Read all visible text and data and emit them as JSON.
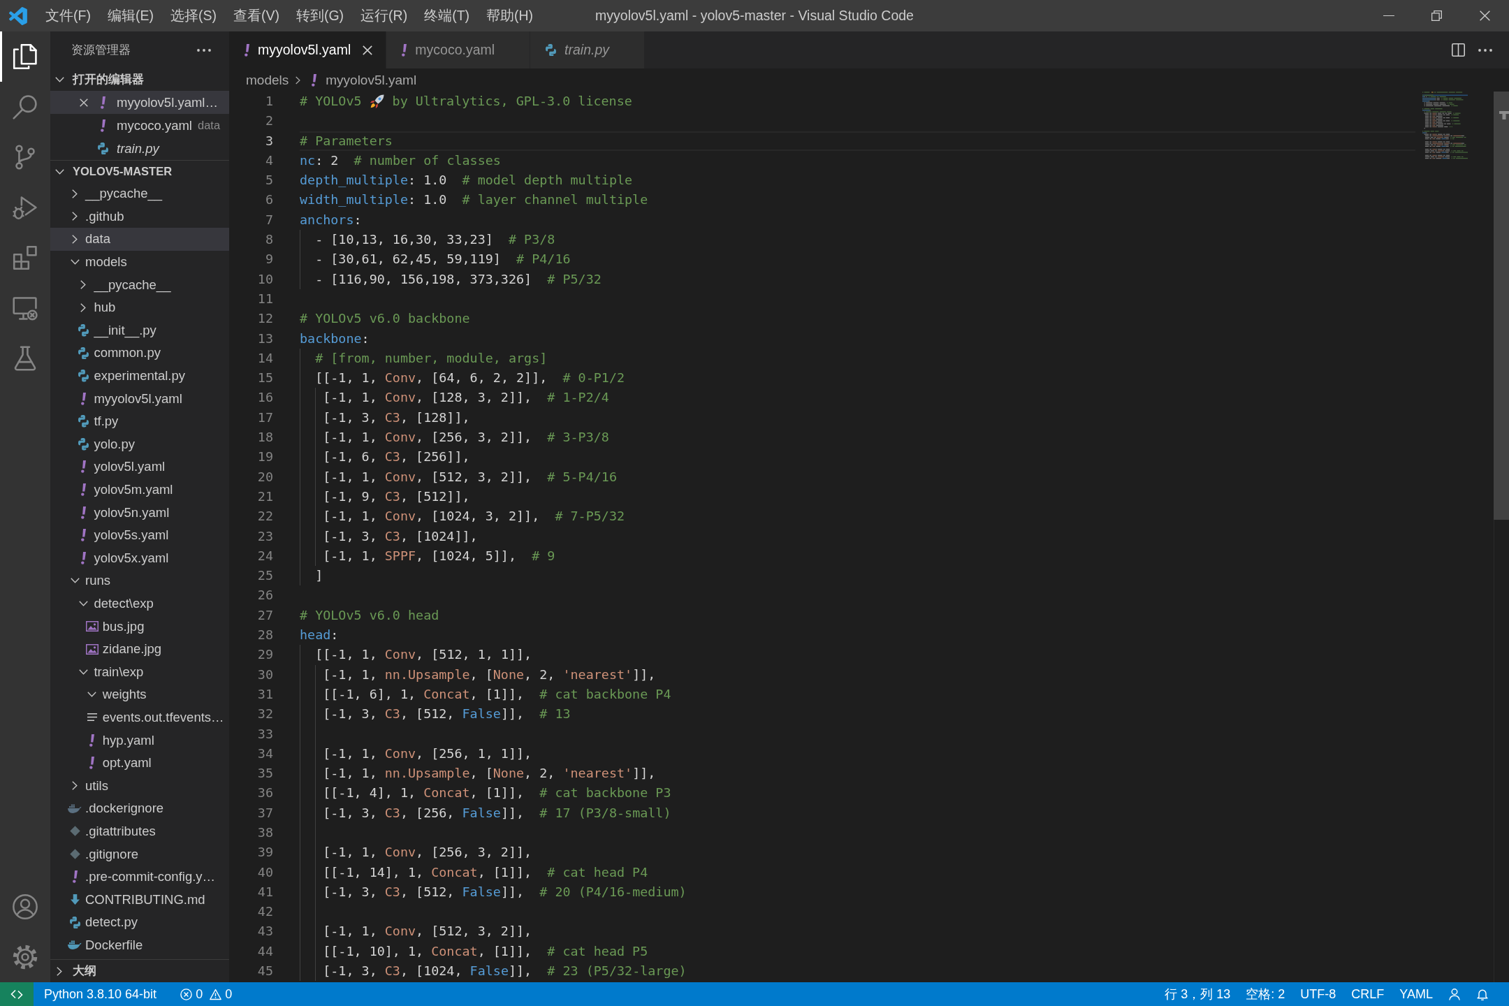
{
  "window": {
    "title": "myyolov5l.yaml - yolov5-master - Visual Studio Code"
  },
  "menu": [
    "文件(F)",
    "编辑(E)",
    "选择(S)",
    "查看(V)",
    "转到(G)",
    "运行(R)",
    "终端(T)",
    "帮助(H)"
  ],
  "activity_bar": {
    "items": [
      {
        "kind": "explorer",
        "selected": true
      },
      {
        "kind": "search",
        "selected": false
      },
      {
        "kind": "source_control",
        "selected": false
      },
      {
        "kind": "run_debug",
        "selected": false
      },
      {
        "kind": "extensions",
        "selected": false
      },
      {
        "kind": "remote",
        "selected": false
      },
      {
        "kind": "testing",
        "selected": false
      }
    ],
    "bottom": [
      {
        "kind": "account"
      },
      {
        "kind": "settings"
      }
    ]
  },
  "sidebar": {
    "title": "资源管理器",
    "sections": [
      {
        "kind": "open_editors",
        "title": "打开的编辑器",
        "expanded": true,
        "items": [
          {
            "name": "myyolov5l.yaml…",
            "kind": "yaml",
            "selected": true,
            "preview": false
          },
          {
            "name": "mycoco.yaml",
            "description": "data",
            "kind": "yaml",
            "selected": false,
            "preview": false
          },
          {
            "name": "train.py",
            "kind": "python",
            "selected": false,
            "preview": true
          }
        ]
      },
      {
        "kind": "folder",
        "title": "YOLOV5-MASTER",
        "expanded": true,
        "items": [
          {
            "name": "__pycache__",
            "kind": "folder",
            "expanded": false,
            "selected": false
          },
          {
            "name": ".github",
            "kind": "folder",
            "expanded": false,
            "selected": false
          },
          {
            "name": "data",
            "kind": "folder",
            "expanded": false,
            "selected": true
          },
          {
            "name": "models",
            "kind": "folder",
            "expanded": true,
            "selected": false,
            "children": [
              {
                "name": "__pycache__",
                "kind": "folder",
                "expanded": false,
                "selected": false
              },
              {
                "name": "hub",
                "kind": "folder",
                "expanded": false,
                "selected": false
              },
              {
                "name": "__init__.py",
                "kind": "python",
                "selected": false
              },
              {
                "name": "common.py",
                "kind": "python",
                "selected": false
              },
              {
                "name": "experimental.py",
                "kind": "python",
                "selected": false
              },
              {
                "name": "myyolov5l.yaml",
                "kind": "yaml",
                "selected": false
              },
              {
                "name": "tf.py",
                "kind": "python",
                "selected": false
              },
              {
                "name": "yolo.py",
                "kind": "python",
                "selected": false
              },
              {
                "name": "yolov5l.yaml",
                "kind": "yaml",
                "selected": false
              },
              {
                "name": "yolov5m.yaml",
                "kind": "yaml",
                "selected": false
              },
              {
                "name": "yolov5n.yaml",
                "kind": "yaml",
                "selected": false
              },
              {
                "name": "yolov5s.yaml",
                "kind": "yaml",
                "selected": false
              },
              {
                "name": "yolov5x.yaml",
                "kind": "yaml",
                "selected": false
              }
            ]
          },
          {
            "name": "runs",
            "kind": "folder",
            "expanded": true,
            "selected": false,
            "children": [
              {
                "name": "detect\\exp",
                "kind": "folder",
                "expanded": true,
                "selected": false,
                "children": [
                  {
                    "name": "bus.jpg",
                    "kind": "image",
                    "selected": false
                  },
                  {
                    "name": "zidane.jpg",
                    "kind": "image",
                    "selected": false
                  }
                ]
              },
              {
                "name": "train\\exp",
                "kind": "folder",
                "expanded": true,
                "selected": false,
                "children": [
                  {
                    "name": "weights",
                    "kind": "folder",
                    "expanded": true,
                    "selected": false
                  },
                  {
                    "name": "events.out.tfevents…",
                    "kind": "text",
                    "selected": false
                  },
                  {
                    "name": "hyp.yaml",
                    "kind": "yaml",
                    "selected": false
                  },
                  {
                    "name": "opt.yaml",
                    "kind": "yaml",
                    "selected": false
                  }
                ]
              }
            ]
          },
          {
            "name": "utils",
            "kind": "folder",
            "expanded": false,
            "selected": false
          },
          {
            "name": ".dockerignore",
            "kind": "docker_ignore",
            "selected": false
          },
          {
            "name": ".gitattributes",
            "kind": "git",
            "selected": false
          },
          {
            "name": ".gitignore",
            "kind": "git",
            "selected": false
          },
          {
            "name": ".pre-commit-config.y…",
            "kind": "yaml",
            "selected": false
          },
          {
            "name": "CONTRIBUTING.md",
            "kind": "markdown",
            "selected": false
          },
          {
            "name": "detect.py",
            "kind": "python",
            "selected": false
          },
          {
            "name": "Dockerfile",
            "kind": "docker",
            "selected": false
          }
        ]
      },
      {
        "kind": "outline",
        "title": "大纲",
        "expanded": false
      }
    ]
  },
  "tabs": [
    {
      "label": "myyolov5l.yaml",
      "kind": "yaml",
      "selected": true,
      "preview": false
    },
    {
      "label": "mycoco.yaml",
      "kind": "yaml",
      "selected": false,
      "preview": false
    },
    {
      "label": "train.py",
      "kind": "python",
      "selected": false,
      "preview": true
    }
  ],
  "breadcrumb": [
    {
      "label": "models",
      "kind": "folder"
    },
    {
      "label": "myyolov5l.yaml",
      "kind": "yaml"
    }
  ],
  "editor": {
    "lines": [
      {
        "number": "1",
        "current": false,
        "tokens": [
          {
            "kind": "comment",
            "text": "# YOLOv5"
          },
          {
            "kind": "emoji"
          },
          {
            "kind": "comment",
            "text": "by Ultralytics, GPL-3.0 license"
          }
        ]
      },
      {
        "number": "2",
        "current": false
      },
      {
        "number": "3",
        "current": true,
        "tokens": [
          {
            "kind": "comment",
            "text": "# Parameters"
          }
        ]
      },
      {
        "number": "4",
        "current": false,
        "tokens": [
          {
            "kind": "key",
            "text": "nc"
          },
          {
            "kind": "plain",
            "text": ": 2  "
          },
          {
            "kind": "comment",
            "text": "# number of classes"
          }
        ]
      },
      {
        "number": "5",
        "current": false,
        "tokens": [
          {
            "kind": "key",
            "text": "depth_multiple"
          },
          {
            "kind": "plain",
            "text": ": 1.0  "
          },
          {
            "kind": "comment",
            "text": "# model depth multiple"
          }
        ]
      },
      {
        "number": "6",
        "current": false,
        "tokens": [
          {
            "kind": "key",
            "text": "width_multiple"
          },
          {
            "kind": "plain",
            "text": ": 1.0  "
          },
          {
            "kind": "comment",
            "text": "# layer channel multiple"
          }
        ]
      },
      {
        "number": "7",
        "current": false,
        "tokens": [
          {
            "kind": "key",
            "text": "anchors"
          },
          {
            "kind": "plain",
            "text": ":"
          }
        ]
      },
      {
        "number": "8",
        "current": false,
        "tokens": [
          {
            "kind": "plain",
            "text": "  - [10,13, 16,30, 33,23]  "
          },
          {
            "kind": "comment",
            "text": "# P3/8"
          }
        ]
      },
      {
        "number": "9",
        "current": false,
        "tokens": [
          {
            "kind": "plain",
            "text": "  - [30,61, 62,45, 59,119]  "
          },
          {
            "kind": "comment",
            "text": "# P4/16"
          }
        ]
      },
      {
        "number": "10",
        "current": false,
        "tokens": [
          {
            "kind": "plain",
            "text": "  - [116,90, 156,198, 373,326]  "
          },
          {
            "kind": "comment",
            "text": "# P5/32"
          }
        ]
      },
      {
        "number": "11",
        "current": false
      },
      {
        "number": "12",
        "current": false,
        "tokens": [
          {
            "kind": "comment",
            "text": "# YOLOv5 v6.0 backbone"
          }
        ]
      },
      {
        "number": "13",
        "current": false,
        "tokens": [
          {
            "kind": "key",
            "text": "backbone"
          },
          {
            "kind": "plain",
            "text": ":"
          }
        ]
      },
      {
        "number": "14",
        "current": false,
        "tokens": [
          {
            "kind": "comment",
            "text": "  # [from, number, module, args]"
          }
        ]
      },
      {
        "number": "15",
        "current": false,
        "tokens": [
          {
            "kind": "plain",
            "text": "  [[-1, 1, "
          },
          {
            "kind": "string",
            "text": "Conv"
          },
          {
            "kind": "plain",
            "text": ", [64, 6, 2, 2]],  "
          },
          {
            "kind": "comment",
            "text": "# 0-P1/2"
          }
        ]
      },
      {
        "number": "16",
        "current": false,
        "tokens": [
          {
            "kind": "plain",
            "text": "   [-1, 1, "
          },
          {
            "kind": "string",
            "text": "Conv"
          },
          {
            "kind": "plain",
            "text": ", [128, 3, 2]],  "
          },
          {
            "kind": "comment",
            "text": "# 1-P2/4"
          }
        ]
      },
      {
        "number": "17",
        "current": false,
        "tokens": [
          {
            "kind": "plain",
            "text": "   [-1, 3, "
          },
          {
            "kind": "string",
            "text": "C3"
          },
          {
            "kind": "plain",
            "text": ", [128]],"
          }
        ]
      },
      {
        "number": "18",
        "current": false,
        "tokens": [
          {
            "kind": "plain",
            "text": "   [-1, 1, "
          },
          {
            "kind": "string",
            "text": "Conv"
          },
          {
            "kind": "plain",
            "text": ", [256, 3, 2]],  "
          },
          {
            "kind": "comment",
            "text": "# 3-P3/8"
          }
        ]
      },
      {
        "number": "19",
        "current": false,
        "tokens": [
          {
            "kind": "plain",
            "text": "   [-1, 6, "
          },
          {
            "kind": "string",
            "text": "C3"
          },
          {
            "kind": "plain",
            "text": ", [256]],"
          }
        ]
      },
      {
        "number": "20",
        "current": false,
        "tokens": [
          {
            "kind": "plain",
            "text": "   [-1, 1, "
          },
          {
            "kind": "string",
            "text": "Conv"
          },
          {
            "kind": "plain",
            "text": ", [512, 3, 2]],  "
          },
          {
            "kind": "comment",
            "text": "# 5-P4/16"
          }
        ]
      },
      {
        "number": "21",
        "current": false,
        "tokens": [
          {
            "kind": "plain",
            "text": "   [-1, 9, "
          },
          {
            "kind": "string",
            "text": "C3"
          },
          {
            "kind": "plain",
            "text": ", [512]],"
          }
        ]
      },
      {
        "number": "22",
        "current": false,
        "tokens": [
          {
            "kind": "plain",
            "text": "   [-1, 1, "
          },
          {
            "kind": "string",
            "text": "Conv"
          },
          {
            "kind": "plain",
            "text": ", [1024, 3, 2]],  "
          },
          {
            "kind": "comment",
            "text": "# 7-P5/32"
          }
        ]
      },
      {
        "number": "23",
        "current": false,
        "tokens": [
          {
            "kind": "plain",
            "text": "   [-1, 3, "
          },
          {
            "kind": "string",
            "text": "C3"
          },
          {
            "kind": "plain",
            "text": ", [1024]],"
          }
        ]
      },
      {
        "number": "24",
        "current": false,
        "tokens": [
          {
            "kind": "plain",
            "text": "   [-1, 1, "
          },
          {
            "kind": "string",
            "text": "SPPF"
          },
          {
            "kind": "plain",
            "text": ", [1024, 5]],  "
          },
          {
            "kind": "comment",
            "text": "# 9"
          }
        ]
      },
      {
        "number": "25",
        "current": false,
        "tokens": [
          {
            "kind": "plain",
            "text": "  ]"
          }
        ]
      },
      {
        "number": "26",
        "current": false
      },
      {
        "number": "27",
        "current": false,
        "tokens": [
          {
            "kind": "comment",
            "text": "# YOLOv5 v6.0 head"
          }
        ]
      },
      {
        "number": "28",
        "current": false,
        "tokens": [
          {
            "kind": "key",
            "text": "head"
          },
          {
            "kind": "plain",
            "text": ":"
          }
        ]
      },
      {
        "number": "29",
        "current": false,
        "tokens": [
          {
            "kind": "plain",
            "text": "  [[-1, 1, "
          },
          {
            "kind": "string",
            "text": "Conv"
          },
          {
            "kind": "plain",
            "text": ", [512, 1, 1]],"
          }
        ]
      },
      {
        "number": "30",
        "current": false,
        "tokens": [
          {
            "kind": "plain",
            "text": "   [-1, 1, "
          },
          {
            "kind": "string",
            "text": "nn.Upsample"
          },
          {
            "kind": "plain",
            "text": ", ["
          },
          {
            "kind": "string",
            "text": "None"
          },
          {
            "kind": "plain",
            "text": ", 2, "
          },
          {
            "kind": "string",
            "text": "'nearest'"
          },
          {
            "kind": "plain",
            "text": "]],"
          }
        ]
      },
      {
        "number": "31",
        "current": false,
        "tokens": [
          {
            "kind": "plain",
            "text": "   [[-1, 6], 1, "
          },
          {
            "kind": "string",
            "text": "Concat"
          },
          {
            "kind": "plain",
            "text": ", [1]],  "
          },
          {
            "kind": "comment",
            "text": "# cat backbone P4"
          }
        ]
      },
      {
        "number": "32",
        "current": false,
        "tokens": [
          {
            "kind": "plain",
            "text": "   [-1, 3, "
          },
          {
            "kind": "string",
            "text": "C3"
          },
          {
            "kind": "plain",
            "text": ", [512, "
          },
          {
            "kind": "bool",
            "text": "False"
          },
          {
            "kind": "plain",
            "text": "]],  "
          },
          {
            "kind": "comment",
            "text": "# 13"
          }
        ]
      },
      {
        "number": "33",
        "current": false
      },
      {
        "number": "34",
        "current": false,
        "tokens": [
          {
            "kind": "plain",
            "text": "   [-1, 1, "
          },
          {
            "kind": "string",
            "text": "Conv"
          },
          {
            "kind": "plain",
            "text": ", [256, 1, 1]],"
          }
        ]
      },
      {
        "number": "35",
        "current": false,
        "tokens": [
          {
            "kind": "plain",
            "text": "   [-1, 1, "
          },
          {
            "kind": "string",
            "text": "nn.Upsample"
          },
          {
            "kind": "plain",
            "text": ", ["
          },
          {
            "kind": "string",
            "text": "None"
          },
          {
            "kind": "plain",
            "text": ", 2, "
          },
          {
            "kind": "string",
            "text": "'nearest'"
          },
          {
            "kind": "plain",
            "text": "]],"
          }
        ]
      },
      {
        "number": "36",
        "current": false,
        "tokens": [
          {
            "kind": "plain",
            "text": "   [[-1, 4], 1, "
          },
          {
            "kind": "string",
            "text": "Concat"
          },
          {
            "kind": "plain",
            "text": ", [1]],  "
          },
          {
            "kind": "comment",
            "text": "# cat backbone P3"
          }
        ]
      },
      {
        "number": "37",
        "current": false,
        "tokens": [
          {
            "kind": "plain",
            "text": "   [-1, 3, "
          },
          {
            "kind": "string",
            "text": "C3"
          },
          {
            "kind": "plain",
            "text": ", [256, "
          },
          {
            "kind": "bool",
            "text": "False"
          },
          {
            "kind": "plain",
            "text": "]],  "
          },
          {
            "kind": "comment",
            "text": "# 17 (P3/8-small)"
          }
        ]
      },
      {
        "number": "38",
        "current": false
      },
      {
        "number": "39",
        "current": false,
        "tokens": [
          {
            "kind": "plain",
            "text": "   [-1, 1, "
          },
          {
            "kind": "string",
            "text": "Conv"
          },
          {
            "kind": "plain",
            "text": ", [256, 3, 2]],"
          }
        ]
      },
      {
        "number": "40",
        "current": false,
        "tokens": [
          {
            "kind": "plain",
            "text": "   [[-1, 14], 1, "
          },
          {
            "kind": "string",
            "text": "Concat"
          },
          {
            "kind": "plain",
            "text": ", [1]],  "
          },
          {
            "kind": "comment",
            "text": "# cat head P4"
          }
        ]
      },
      {
        "number": "41",
        "current": false,
        "tokens": [
          {
            "kind": "plain",
            "text": "   [-1, 3, "
          },
          {
            "kind": "string",
            "text": "C3"
          },
          {
            "kind": "plain",
            "text": ", [512, "
          },
          {
            "kind": "bool",
            "text": "False"
          },
          {
            "kind": "plain",
            "text": "]],  "
          },
          {
            "kind": "comment",
            "text": "# 20 (P4/16-medium)"
          }
        ]
      },
      {
        "number": "42",
        "current": false
      },
      {
        "number": "43",
        "current": false,
        "tokens": [
          {
            "kind": "plain",
            "text": "   [-1, 1, "
          },
          {
            "kind": "string",
            "text": "Conv"
          },
          {
            "kind": "plain",
            "text": ", [512, 3, 2]],"
          }
        ]
      },
      {
        "number": "44",
        "current": false,
        "tokens": [
          {
            "kind": "plain",
            "text": "   [[-1, 10], 1, "
          },
          {
            "kind": "string",
            "text": "Concat"
          },
          {
            "kind": "plain",
            "text": ", [1]],  "
          },
          {
            "kind": "comment",
            "text": "# cat head P5"
          }
        ]
      },
      {
        "number": "45",
        "current": false,
        "tokens": [
          {
            "kind": "plain",
            "text": "   [-1, 3, "
          },
          {
            "kind": "string",
            "text": "C3"
          },
          {
            "kind": "plain",
            "text": ", [1024, "
          },
          {
            "kind": "bool",
            "text": "False"
          },
          {
            "kind": "plain",
            "text": "]],  "
          },
          {
            "kind": "comment",
            "text": "# 23 (P5/32-large)"
          }
        ]
      }
    ]
  },
  "status_bar": {
    "interpreter": "Python 3.8.10 64-bit",
    "errors": "0",
    "warnings": "0",
    "cursor": "行 3，列 13",
    "indentation": "空格: 2",
    "encoding": "UTF-8",
    "line_ending": "CRLF",
    "language": "YAML"
  }
}
